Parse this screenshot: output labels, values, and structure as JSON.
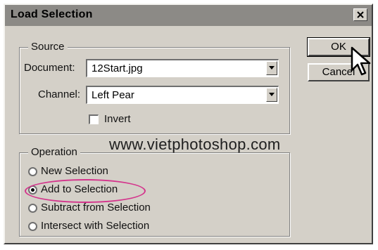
{
  "dialog": {
    "title": "Load Selection"
  },
  "source": {
    "label": "Source",
    "document_label": "Document:",
    "document_value": "12Start.jpg",
    "channel_label": "Channel:",
    "channel_value": "Left Pear",
    "invert_label": "Invert",
    "invert_checked": false
  },
  "operation": {
    "label": "Operation",
    "options": [
      {
        "label": "New Selection",
        "selected": false
      },
      {
        "label": "Add to Selection",
        "selected": true
      },
      {
        "label": "Subtract from Selection",
        "selected": false
      },
      {
        "label": "Intersect with Selection",
        "selected": false
      }
    ]
  },
  "buttons": {
    "ok": "OK",
    "cancel": "Cancel"
  },
  "watermark": "www.vietphotoshop.com",
  "colors": {
    "dialog_bg": "#d4d0c8",
    "titlebar_bg": "#8c8a86",
    "highlight": "#d4348c"
  }
}
